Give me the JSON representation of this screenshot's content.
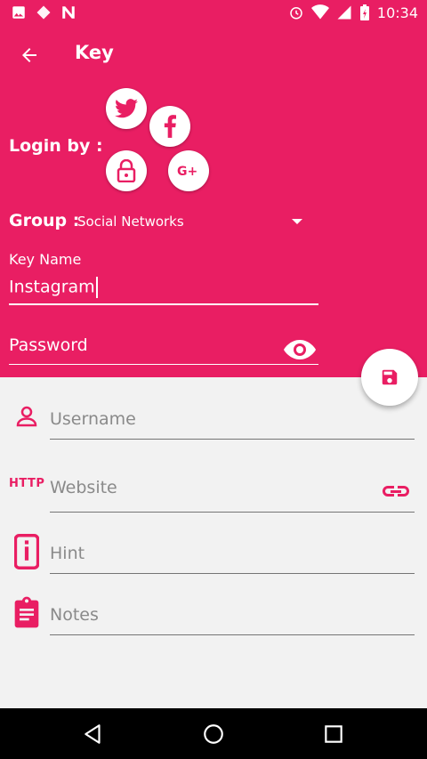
{
  "status_bar": {
    "time": "10:34"
  },
  "toolbar": {
    "title": "Key"
  },
  "login": {
    "label": "Login by :"
  },
  "group": {
    "label": "Group :",
    "value": "Social Networks"
  },
  "key_name": {
    "label": "Key Name",
    "value": "Instagram"
  },
  "password": {
    "placeholder": "Password"
  },
  "fields": {
    "username": "Username",
    "http_badge": "HTTP",
    "website": "Website",
    "hint": "Hint",
    "notes": "Notes"
  },
  "colors": {
    "accent": "#e91e63",
    "background": "#f2f2f2",
    "underline": "#757575"
  },
  "icons": [
    "twitter-icon",
    "facebook-icon",
    "lock-icon",
    "google-plus-icon",
    "eye-icon",
    "save-icon",
    "person-icon",
    "link-icon",
    "info-icon",
    "clipboard-icon"
  ]
}
